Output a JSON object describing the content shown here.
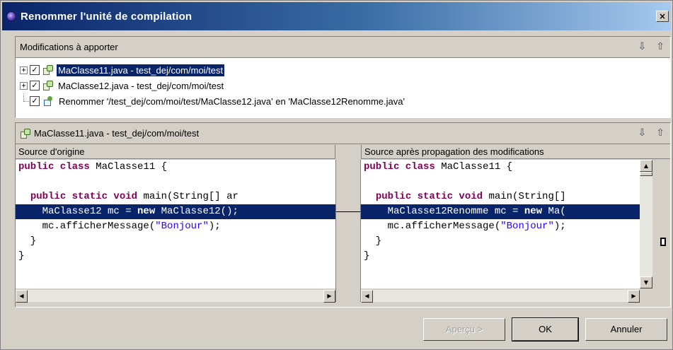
{
  "window": {
    "title": "Renommer l'unité de compilation",
    "close_label": "×"
  },
  "changes": {
    "header": "Modifications à apporter",
    "nav_down": "⇩",
    "nav_up": "⇧",
    "items": [
      {
        "label": "MaClasse11.java - test_dej/com/moi/test",
        "expander": "+",
        "checked": "✓"
      },
      {
        "label": "MaClasse12.java - test_dej/com/moi/test",
        "expander": "+",
        "checked": "✓"
      },
      {
        "label": "Renommer '/test_dej/com/moi/test/MaClasse12.java' en 'MaClasse12Renomme.java'",
        "checked": "✓"
      }
    ]
  },
  "compare": {
    "header": "MaClasse11.java - test_dej/com/moi/test",
    "nav_down": "⇩",
    "nav_up": "⇧",
    "left_title": "Source d'origine",
    "right_title": "Source après propagation des modifications",
    "left_code": {
      "l1a": "public class",
      "l1b": " MaClasse11 {",
      "l3a": "  ",
      "l3b": "public static void",
      "l3c": " main(String[] ar",
      "l4a": "    MaClasse12 mc = ",
      "l4b": "new",
      "l4c": " MaClasse12();",
      "l5a": "    mc.afficherMessage(",
      "l5b": "\"Bonjour\"",
      "l5c": ");",
      "l6": "  }",
      "l7": "}"
    },
    "right_code": {
      "l1a": "public class",
      "l1b": " MaClasse11 {",
      "l3a": "  ",
      "l3b": "public static void",
      "l3c": " main(String[]",
      "l4a": "    MaClasse12Renomme mc = ",
      "l4b": "new",
      "l4c": " Ma(",
      "l5a": "    mc.afficherMessage(",
      "l5b": "\"Bonjour\"",
      "l5c": ");",
      "l6": "  }",
      "l7": "}"
    }
  },
  "buttons": {
    "preview": "Aperçu >",
    "ok": "OK",
    "cancel": "Annuler"
  },
  "scroll": {
    "left": "◀",
    "right": "▶",
    "up": "▲",
    "down": "▼"
  },
  "colors": {
    "selection": "#0a246a",
    "keyword": "#7f0055",
    "string": "#2a00ff"
  }
}
